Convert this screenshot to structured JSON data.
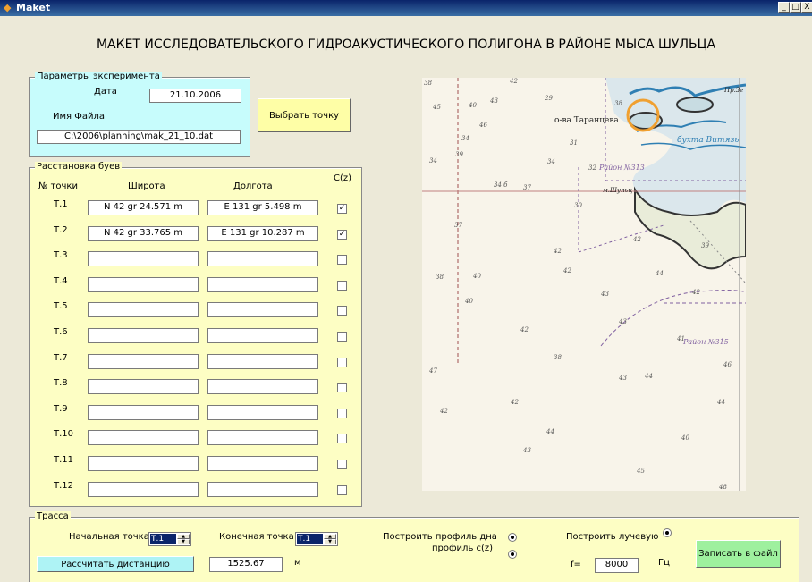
{
  "window": {
    "title": "Maket",
    "btn_min": "_",
    "btn_max": "□",
    "btn_close": "X"
  },
  "header": {
    "title": "МАКЕТ ИССЛЕДОВАТЕЛЬСКОГО ГИДРОАКУСТИЧЕСКОГО ПОЛИГОНА В РАЙОНЕ МЫСА ШУЛЬЦА"
  },
  "params": {
    "legend": "Параметры эксперимента",
    "date_label": "Дата",
    "date_value": "21.10.2006",
    "file_label": "Имя Файла",
    "file_value": "C:\\2006\\planning\\mak_21_10.dat"
  },
  "select_point_button": "Выбрать точку",
  "buoys": {
    "legend": "Расстановка буев",
    "col_point": "№ точки",
    "col_lat": "Широта",
    "col_lon": "Долгота",
    "col_cz": "C(z)",
    "rows": [
      {
        "label": "Т.1",
        "lat": "N 42 gr 24.571 m",
        "lon": "E 131 gr  5.498 m",
        "checked": "✓"
      },
      {
        "label": "Т.2",
        "lat": "N 42 gr 33.765 m",
        "lon": "E 131 gr 10.287 m",
        "checked": "✓"
      },
      {
        "label": "Т.3",
        "lat": "",
        "lon": "",
        "checked": ""
      },
      {
        "label": "Т.4",
        "lat": "",
        "lon": "",
        "checked": ""
      },
      {
        "label": "Т.5",
        "lat": "",
        "lon": "",
        "checked": ""
      },
      {
        "label": "Т.6",
        "lat": "",
        "lon": "",
        "checked": ""
      },
      {
        "label": "Т.7",
        "lat": "",
        "lon": "",
        "checked": ""
      },
      {
        "label": "Т.8",
        "lat": "",
        "lon": "",
        "checked": ""
      },
      {
        "label": "Т.9",
        "lat": "",
        "lon": "",
        "checked": ""
      },
      {
        "label": "Т.10",
        "lat": "",
        "lon": "",
        "checked": ""
      },
      {
        "label": "Т.11",
        "lat": "",
        "lon": "",
        "checked": ""
      },
      {
        "label": "Т.12",
        "lat": "",
        "lon": "",
        "checked": ""
      }
    ]
  },
  "map": {
    "labels": {
      "islands": "о-ва Таранцева",
      "bay": "бухта Витязь",
      "region_313": "Район №313",
      "region_315": "Район №315",
      "pt": "Пр.Зе",
      "shultz": "м.Шульц"
    },
    "depths": [
      "38",
      "42",
      "45",
      "29",
      "43",
      "38",
      "40",
      "46",
      "34",
      "31",
      "34",
      "39",
      "32",
      "34 б",
      "34",
      "37",
      "37",
      "30",
      "42",
      "42",
      "39",
      "38",
      "40",
      "42",
      "44",
      "42",
      "43",
      "40",
      "43",
      "42",
      "41",
      "38",
      "47",
      "46",
      "43",
      "44",
      "42",
      "44",
      "44",
      "40",
      "42",
      "43",
      "48",
      "45"
    ]
  },
  "trace": {
    "legend": "Трасса",
    "start_label": "Начальная точка",
    "start_value": "Т.1",
    "end_label": "Конечная точка",
    "end_value": "Т.1",
    "bottom_profile_label": "Построить профиль дна",
    "cz_profile_label": "профиль с(z)",
    "ray_label": "Построить лучевую",
    "calc_button": "Рассчитать дистанцию",
    "distance_value": "1525.67",
    "distance_unit": "м",
    "freq_label": "f=",
    "freq_value": "8000",
    "freq_unit": "Гц",
    "save_button": "Записать в файл"
  }
}
